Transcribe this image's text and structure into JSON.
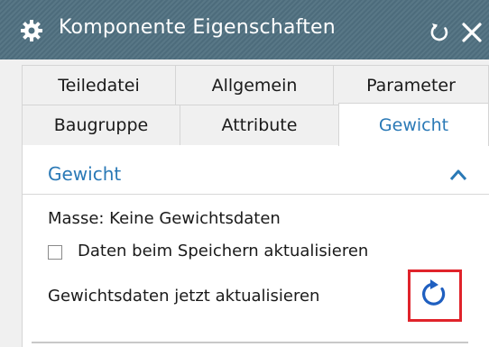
{
  "title_bar": {
    "title": "Komponente Eigenschaften"
  },
  "tabs": [
    {
      "label": "Teiledatei",
      "active": false
    },
    {
      "label": "Allgemein",
      "active": false
    },
    {
      "label": "Parameter",
      "active": false
    },
    {
      "label": "Baugruppe",
      "active": false
    },
    {
      "label": "Attribute",
      "active": false
    },
    {
      "label": "Gewicht",
      "active": true
    }
  ],
  "section": {
    "title": "Gewicht",
    "expanded": true,
    "mass_text": "Masse: Keine Gewichtsdaten",
    "save_checkbox_label": "Daten beim Speichern aktualisieren",
    "save_checkbox_checked": false,
    "update_label": "Gewichtsdaten jetzt aktualisieren",
    "update_icon": "refresh-icon"
  },
  "colors": {
    "titlebar": "#4f7080",
    "accent_blue": "#2a79b6",
    "highlight_red": "#e0232b"
  }
}
